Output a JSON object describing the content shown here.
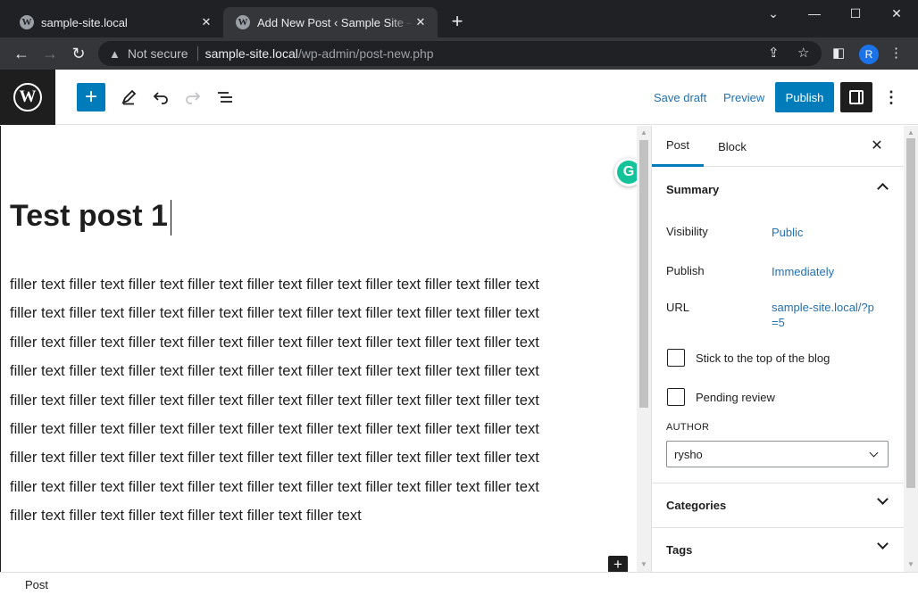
{
  "browser": {
    "tabs": [
      {
        "title": "sample-site.local",
        "favicon": "wordpress-icon",
        "active": false
      },
      {
        "title": "Add New Post ‹ Sample Site — WordPress",
        "favicon": "wordpress-icon",
        "active": true
      }
    ],
    "new_tab_symbol": "+",
    "window_controls": {
      "minimize": "—",
      "maximize": "☐",
      "close": "✕",
      "tab_search": "⌄"
    },
    "omnibox": {
      "security_text": "Not secure",
      "host": "sample-site.local",
      "path": "/wp-admin/post-new.php"
    },
    "profile_initial": "R"
  },
  "editor_header": {
    "save_draft_label": "Save draft",
    "preview_label": "Preview",
    "publish_label": "Publish"
  },
  "post": {
    "title": "Test post 1",
    "body": "filler text filler text filler text filler text filler text filler text filler text filler text filler text\nfiller text filler text filler text filler text filler text filler text filler text filler text filler text\nfiller text filler text filler text filler text filler text filler text filler text filler text filler text\nfiller text filler text filler text filler text filler text filler text filler text filler text filler text\nfiller text filler text filler text filler text filler text filler text filler text filler text filler text\nfiller text filler text filler text filler text filler text filler text filler text filler text filler text\nfiller text filler text filler text filler text filler text filler text filler text filler text filler text\nfiller text filler text filler text filler text filler text filler text filler text filler text filler text\nfiller text filler text filler text filler text filler text filler text"
  },
  "sidebar": {
    "tabs": {
      "post": "Post",
      "block": "Block"
    },
    "close_symbol": "✕",
    "summary": {
      "heading": "Summary",
      "visibility_label": "Visibility",
      "visibility_value": "Public",
      "publish_label": "Publish",
      "publish_value": "Immediately",
      "url_label": "URL",
      "url_value": "sample-site.local/?p=5",
      "stick_label": "Stick to the top of the blog",
      "pending_label": "Pending review",
      "author_label": "AUTHOR",
      "author_value": "rysho"
    },
    "categories_heading": "Categories",
    "tags_heading": "Tags"
  },
  "footer": {
    "breadcrumb": "Post"
  }
}
